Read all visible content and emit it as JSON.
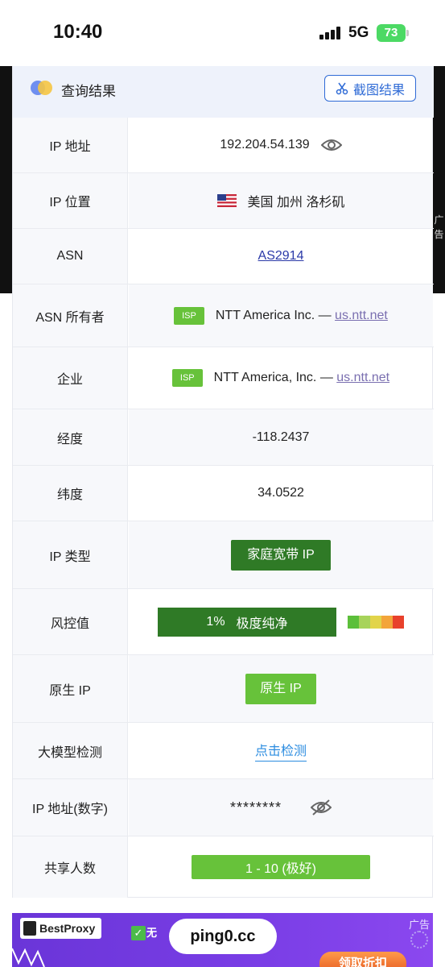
{
  "status_bar": {
    "time": "10:40",
    "network": "5G",
    "battery": "73"
  },
  "side_ad_label": "广告",
  "header": {
    "title": "查询结果",
    "screenshot_button": "截图结果"
  },
  "rows": {
    "ip_address": {
      "label": "IP 地址",
      "value": "192.204.54.139"
    },
    "ip_location": {
      "label": "IP 位置",
      "value": "美国 加州 洛杉矶"
    },
    "asn": {
      "label": "ASN",
      "value": "AS2914"
    },
    "asn_owner": {
      "label": "ASN 所有者",
      "badge": "ISP",
      "name": "NTT America Inc. — ",
      "link": "us.ntt.net"
    },
    "enterprise": {
      "label": "企业",
      "badge": "ISP",
      "name": "NTT America, Inc. — ",
      "link": "us.ntt.net"
    },
    "longitude": {
      "label": "经度",
      "value": "-118.2437"
    },
    "latitude": {
      "label": "纬度",
      "value": "34.0522"
    },
    "ip_type": {
      "label": "IP 类型",
      "value": "家庭宽带 IP"
    },
    "risk": {
      "label": "风控值",
      "percent": "1%",
      "text": "极度纯净",
      "scale_colors": [
        "#5cbf3a",
        "#a7d35a",
        "#e2d44a",
        "#f3a53a",
        "#e8412c"
      ]
    },
    "native_ip": {
      "label": "原生 IP",
      "value": "原生 IP"
    },
    "llm_detect": {
      "label": "大模型检测",
      "value": "点击检测"
    },
    "ip_numeric": {
      "label": "IP 地址(数字)",
      "value": "********"
    },
    "shared_users": {
      "label": "共享人数",
      "value": "1 - 10 (极好)"
    }
  },
  "ad_banner": {
    "brand": "BestProxy",
    "check_text": "无",
    "domain": "ping0.cc",
    "label": "广告",
    "cta": "领取折扣"
  },
  "colors": {
    "accent_blue": "#2f6bd6",
    "dark_green": "#2f7a26",
    "green": "#67c23a",
    "ad_purple": "#7a3ee6"
  }
}
